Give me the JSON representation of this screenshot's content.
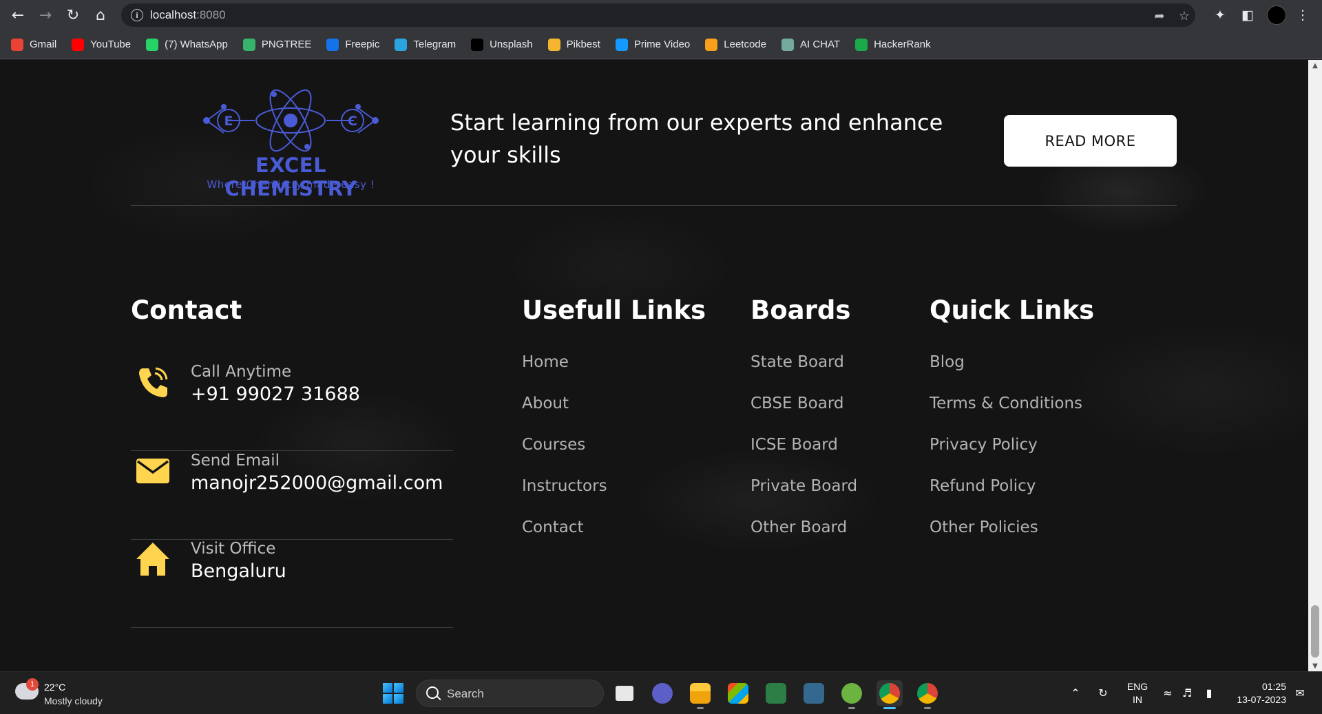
{
  "browser": {
    "url_host": "localhost",
    "url_port": ":8080",
    "bookmarks": [
      {
        "label": "Gmail",
        "icon": "gmail-icon",
        "color": "#ea4335"
      },
      {
        "label": "YouTube",
        "icon": "youtube-icon",
        "color": "#ff0000"
      },
      {
        "label": "(7) WhatsApp",
        "icon": "whatsapp-icon",
        "color": "#25d366"
      },
      {
        "label": "PNGTREE",
        "icon": "pngtree-icon",
        "color": "#37b36b"
      },
      {
        "label": "Freepic",
        "icon": "freepik-icon",
        "color": "#1273eb"
      },
      {
        "label": "Telegram",
        "icon": "telegram-icon",
        "color": "#2aa3de"
      },
      {
        "label": "Unsplash",
        "icon": "unsplash-icon",
        "color": "#000000"
      },
      {
        "label": "Pikbest",
        "icon": "pikbest-icon",
        "color": "#f6b531"
      },
      {
        "label": "Prime Video",
        "icon": "prime-video-icon",
        "color": "#1399ff"
      },
      {
        "label": "Leetcode",
        "icon": "leetcode-icon",
        "color": "#f89f1b"
      },
      {
        "label": "AI CHAT",
        "icon": "ai-chat-icon",
        "color": "#74aa9c"
      },
      {
        "label": "HackerRank",
        "icon": "hackerrank-icon",
        "color": "#1ba94c"
      }
    ]
  },
  "brand": {
    "letters": [
      "E",
      "C"
    ],
    "name": "EXCEL CHEMISTRY",
    "tagline": "Where Chemistry made easy !",
    "color": "#4a5bd6"
  },
  "cta": {
    "text": "Start learning from our experts and enhance your skills",
    "button": "READ MORE"
  },
  "contact": {
    "title": "Contact",
    "icon_color": "#ffd54f",
    "items": [
      {
        "icon": "phone-icon",
        "label": "Call Anytime",
        "value": "+91 99027 31688"
      },
      {
        "icon": "mail-icon",
        "label": "Send Email",
        "value": "manojr252000@gmail.com"
      },
      {
        "icon": "home-icon",
        "label": "Visit Office",
        "value": "Bengaluru"
      }
    ]
  },
  "useful_links": {
    "title": "Usefull Links",
    "items": [
      "Home",
      "About",
      "Courses",
      "Instructors",
      "Contact"
    ]
  },
  "boards": {
    "title": "Boards",
    "items": [
      "State Board",
      "CBSE Board",
      "ICSE Board",
      "Private Board",
      "Other Board"
    ]
  },
  "quick_links": {
    "title": "Quick Links",
    "items": [
      "Blog",
      "Terms & Conditions",
      "Privacy Policy",
      "Refund Policy",
      "Other Policies"
    ]
  },
  "taskbar": {
    "weather_badge": "1",
    "temperature": "22°C",
    "weather": "Mostly cloudy",
    "search_label": "Search",
    "lang_line1": "ENG",
    "lang_line2": "IN",
    "time": "01:25",
    "date": "13-07-2023"
  }
}
